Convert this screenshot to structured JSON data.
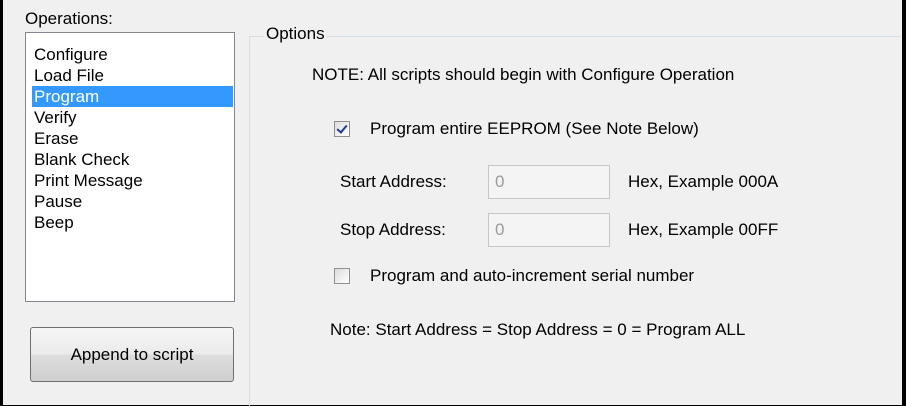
{
  "operations": {
    "label": "Operations:",
    "items": [
      {
        "label": "Configure",
        "selected": false
      },
      {
        "label": "Load File",
        "selected": false
      },
      {
        "label": "Program",
        "selected": true
      },
      {
        "label": "Verify",
        "selected": false
      },
      {
        "label": "Erase",
        "selected": false
      },
      {
        "label": "Blank Check",
        "selected": false
      },
      {
        "label": "Print Message",
        "selected": false
      },
      {
        "label": "Pause",
        "selected": false
      },
      {
        "label": "Beep",
        "selected": false
      }
    ],
    "append_button_label": "Append to script"
  },
  "options": {
    "legend": "Options",
    "note_top": "NOTE: All scripts should begin with Configure Operation",
    "program_entire": {
      "label": "Program entire EEPROM (See Note Below)",
      "checked": true
    },
    "start_address": {
      "label": "Start Address:",
      "value": "0",
      "hint": "Hex, Example 000A"
    },
    "stop_address": {
      "label": "Stop Address:",
      "value": "0",
      "hint": "Hex, Example 00FF"
    },
    "auto_increment": {
      "label": "Program and auto-increment serial number",
      "checked": false
    },
    "note_bottom": "Note: Start Address = Stop Address = 0 = Program ALL"
  },
  "colors": {
    "selection": "#3399ff",
    "background": "#f0f0f0",
    "checkmark": "#1f3a93"
  }
}
